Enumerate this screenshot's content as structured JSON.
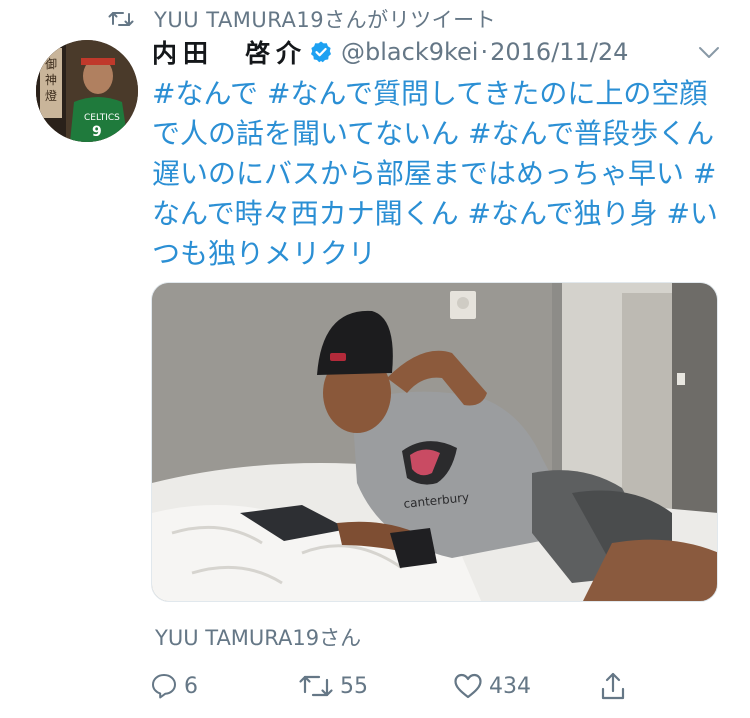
{
  "retweet": {
    "text": "YUU TAMURA19さんがリツイート",
    "icon": "retweet-icon"
  },
  "tweet": {
    "name": "内田　啓介",
    "handle": "@black9kei",
    "separator": "·",
    "date": "2016/11/24",
    "verified_icon": "verified-badge-icon",
    "text": "#なんで #なんで質問してきたのに上の空顔で人の話を聞いてないん #なんで普段歩くん遅いのにバスから部屋まではめっちゃ早い #なんで時々西カナ聞くん #なんで独り身 #いつも独りメリクリ"
  },
  "social_context": "YUU TAMURA19さん",
  "actions": {
    "reply_count": "6",
    "retweet_count": "55",
    "like_count": "434"
  },
  "colors": {
    "link": "#2b8fd4",
    "muted": "#657786",
    "verified": "#1da1f2"
  }
}
